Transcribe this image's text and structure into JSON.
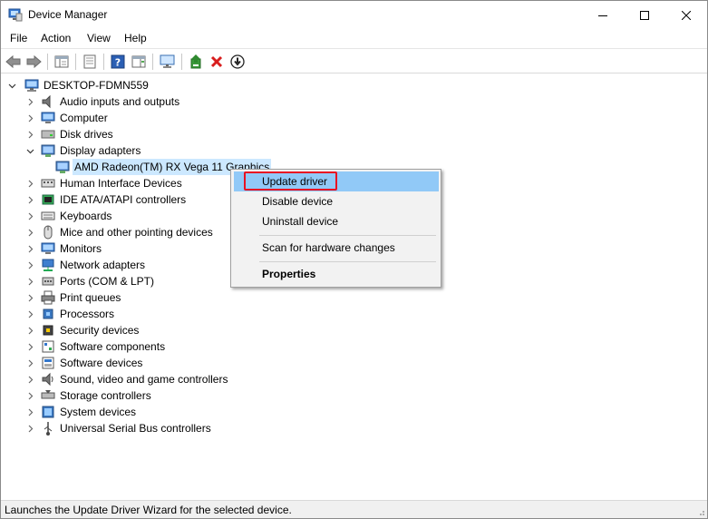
{
  "window": {
    "title": "Device Manager"
  },
  "menu": [
    "File",
    "Action",
    "View",
    "Help"
  ],
  "toolbar": {
    "buttons": [
      "back-icon",
      "forward-icon",
      "show-hide-console-tree-icon",
      "properties-sheet-icon",
      "help-icon",
      "action-pane-icon",
      "scan-monitor-icon",
      "update-driver-icon",
      "uninstall-x-icon",
      "disable-device-icon"
    ]
  },
  "tree": {
    "root": "DESKTOP-FDMN559",
    "categories": [
      "Audio inputs and outputs",
      "Computer",
      "Disk drives",
      "Display adapters",
      "Human Interface Devices",
      "IDE ATA/ATAPI controllers",
      "Keyboards",
      "Mice and other pointing devices",
      "Monitors",
      "Network adapters",
      "Ports (COM & LPT)",
      "Print queues",
      "Processors",
      "Security devices",
      "Software components",
      "Software devices",
      "Sound, video and game controllers",
      "Storage controllers",
      "System devices",
      "Universal Serial Bus controllers"
    ],
    "expanded_child": "AMD Radeon(TM) RX Vega 11 Graphics"
  },
  "context_menu": {
    "items": [
      "Update driver",
      "Disable device",
      "Uninstall device",
      "Scan for hardware changes",
      "Properties"
    ]
  },
  "status": {
    "text": "Launches the Update Driver Wizard for the selected device."
  },
  "colors": {
    "selection": "#cce8ff",
    "menu_highlight": "#91c9f7",
    "callout_red": "#e81123"
  }
}
